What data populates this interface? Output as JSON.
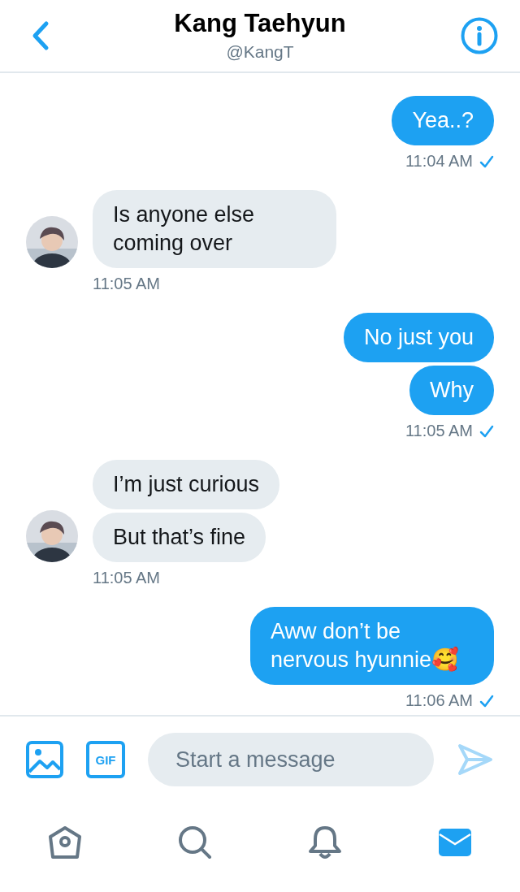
{
  "header": {
    "title": "Kang Taehyun",
    "handle": "@KangT"
  },
  "messages": [
    {
      "kind": "sent",
      "bubbles": [
        "Yea..?"
      ],
      "time": "11:04 AM",
      "read": true
    },
    {
      "kind": "received",
      "bubbles": [
        "Is anyone else coming over"
      ],
      "time": "11:05 AM"
    },
    {
      "kind": "sent",
      "bubbles": [
        "No just you",
        "Why"
      ],
      "time": "11:05 AM",
      "read": true
    },
    {
      "kind": "received",
      "bubbles": [
        "I’m just curious",
        "But that’s fine"
      ],
      "time": "11:05 AM"
    },
    {
      "kind": "sent",
      "bubbles": [
        "Aww don’t be nervous hyunnie🥰"
      ],
      "time": "11:06 AM",
      "read": true
    }
  ],
  "composer": {
    "gif_label": "GIF",
    "placeholder": "Start a message"
  },
  "tabs": [
    {
      "kind": "home",
      "selected": false
    },
    {
      "kind": "search",
      "selected": false
    },
    {
      "kind": "notifications",
      "selected": false
    },
    {
      "kind": "messages",
      "selected": true
    }
  ]
}
